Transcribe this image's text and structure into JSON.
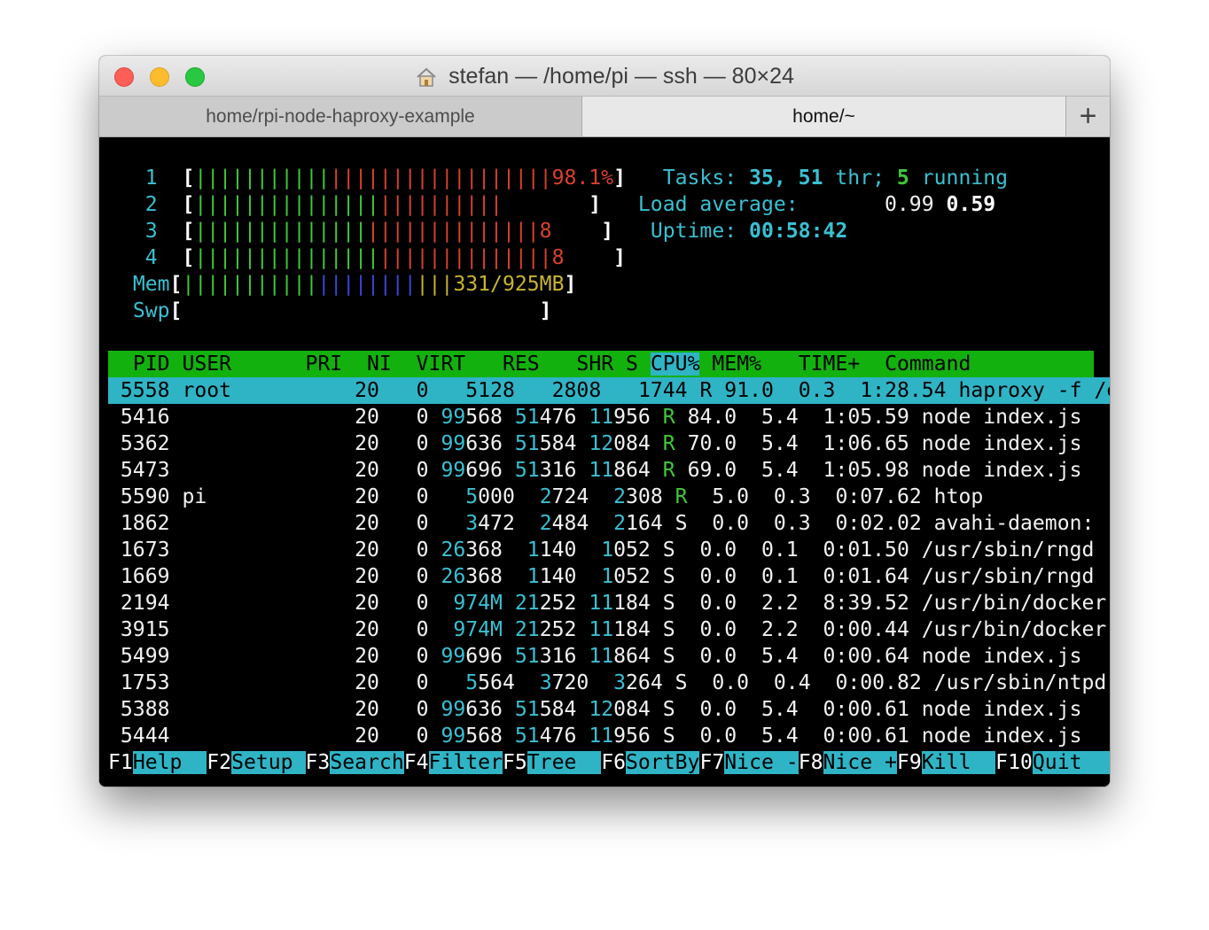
{
  "window": {
    "title": "stefan — /home/pi — ssh — 80×24",
    "tabs": [
      {
        "label": "home/rpi-node-haproxy-example",
        "active": false
      },
      {
        "label": "home/~",
        "active": true
      }
    ],
    "add_tab_label": "+"
  },
  "meters": {
    "cpu": [
      {
        "id": "1",
        "bar_green": "|||||||||||",
        "bar_red": "||||||||||||||||||",
        "label": "98.1%"
      },
      {
        "id": "2",
        "bar_green": "|||||||||||||||",
        "bar_red": "||||||||||",
        "label": ""
      },
      {
        "id": "3",
        "bar_green": "||||||||||||||",
        "bar_red": "||||||||||||||",
        "label": "8"
      },
      {
        "id": "4",
        "bar_green": "|||||||||||||||",
        "bar_red": "||||||||||||||",
        "label": "8"
      }
    ],
    "mem": {
      "id": "Mem",
      "bar_green": "|||||||||||",
      "bar_blue": "||||||||",
      "bar_yellow": "|||",
      "label": "331/925MB"
    },
    "swp": {
      "id": "Swp",
      "label": ""
    }
  },
  "summary": {
    "tasks_label": "Tasks:",
    "tasks_count": "35,",
    "threads_count": "51",
    "threads_label": "thr;",
    "running_count": "5",
    "running_label": "running",
    "load_label": "Load average:",
    "load_1": "0.99",
    "load_5": "0.59",
    "uptime_label": "Uptime:",
    "uptime_value": "00:58:42"
  },
  "table": {
    "columns": {
      "pid": "PID",
      "user": "USER",
      "pri": "PRI",
      "ni": "NI",
      "virt": "VIRT",
      "res": "RES",
      "shr": "SHR",
      "s": "S",
      "cpu": "CPU%",
      "mem": "MEM%",
      "time": "TIME+",
      "command": "Command"
    },
    "rows": [
      {
        "pid": "5558",
        "user": "root",
        "pri": "20",
        "ni": "0",
        "virt": "5128",
        "res": "2808",
        "shr": "1744",
        "s": "R",
        "cpu": "91.0",
        "mem": "0.3",
        "time": "1:28.54",
        "command": "haproxy -f /etc/h"
      },
      {
        "pid": "5416",
        "user": "",
        "pri": "20",
        "ni": "0",
        "virt": "99568",
        "res": "51476",
        "shr": "11956",
        "s": "R",
        "cpu": "84.0",
        "mem": "5.4",
        "time": "1:05.59",
        "command": "node index.js"
      },
      {
        "pid": "5362",
        "user": "",
        "pri": "20",
        "ni": "0",
        "virt": "99636",
        "res": "51584",
        "shr": "12084",
        "s": "R",
        "cpu": "70.0",
        "mem": "5.4",
        "time": "1:06.65",
        "command": "node index.js"
      },
      {
        "pid": "5473",
        "user": "",
        "pri": "20",
        "ni": "0",
        "virt": "99696",
        "res": "51316",
        "shr": "11864",
        "s": "R",
        "cpu": "69.0",
        "mem": "5.4",
        "time": "1:05.98",
        "command": "node index.js"
      },
      {
        "pid": "5590",
        "user": "pi",
        "pri": "20",
        "ni": "0",
        "virt": "5000",
        "res": "2724",
        "shr": "2308",
        "s": "R",
        "cpu": "5.0",
        "mem": "0.3",
        "time": "0:07.62",
        "command": "htop"
      },
      {
        "pid": "1862",
        "user": "",
        "pri": "20",
        "ni": "0",
        "virt": "3472",
        "res": "2484",
        "shr": "2164",
        "s": "S",
        "cpu": "0.0",
        "mem": "0.3",
        "time": "0:02.02",
        "command": "avahi-daemon: run"
      },
      {
        "pid": "1673",
        "user": "",
        "pri": "20",
        "ni": "0",
        "virt": "26368",
        "res": "1140",
        "shr": "1052",
        "s": "S",
        "cpu": "0.0",
        "mem": "0.1",
        "time": "0:01.50",
        "command": "/usr/sbin/rngd -r"
      },
      {
        "pid": "1669",
        "user": "",
        "pri": "20",
        "ni": "0",
        "virt": "26368",
        "res": "1140",
        "shr": "1052",
        "s": "S",
        "cpu": "0.0",
        "mem": "0.1",
        "time": "0:01.64",
        "command": "/usr/sbin/rngd -r"
      },
      {
        "pid": "2194",
        "user": "",
        "pri": "20",
        "ni": "0",
        "virt": "974M",
        "res": "21252",
        "shr": "11184",
        "s": "S",
        "cpu": "0.0",
        "mem": "2.2",
        "time": "8:39.52",
        "command": "/usr/bin/docker -"
      },
      {
        "pid": "3915",
        "user": "",
        "pri": "20",
        "ni": "0",
        "virt": "974M",
        "res": "21252",
        "shr": "11184",
        "s": "S",
        "cpu": "0.0",
        "mem": "2.2",
        "time": "0:00.44",
        "command": "/usr/bin/docker -"
      },
      {
        "pid": "5499",
        "user": "",
        "pri": "20",
        "ni": "0",
        "virt": "99696",
        "res": "51316",
        "shr": "11864",
        "s": "S",
        "cpu": "0.0",
        "mem": "5.4",
        "time": "0:00.64",
        "command": "node index.js"
      },
      {
        "pid": "1753",
        "user": "",
        "pri": "20",
        "ni": "0",
        "virt": "5564",
        "res": "3720",
        "shr": "3264",
        "s": "S",
        "cpu": "0.0",
        "mem": "0.4",
        "time": "0:00.82",
        "command": "/usr/sbin/ntpd -p"
      },
      {
        "pid": "5388",
        "user": "",
        "pri": "20",
        "ni": "0",
        "virt": "99636",
        "res": "51584",
        "shr": "12084",
        "s": "S",
        "cpu": "0.0",
        "mem": "5.4",
        "time": "0:00.61",
        "command": "node index.js"
      },
      {
        "pid": "5444",
        "user": "",
        "pri": "20",
        "ni": "0",
        "virt": "99568",
        "res": "51476",
        "shr": "11956",
        "s": "S",
        "cpu": "0.0",
        "mem": "5.4",
        "time": "0:00.61",
        "command": "node index.js"
      }
    ]
  },
  "function_keys": [
    {
      "key": "F1",
      "label": "Help"
    },
    {
      "key": "F2",
      "label": "Setup"
    },
    {
      "key": "F3",
      "label": "Search"
    },
    {
      "key": "F4",
      "label": "Filter"
    },
    {
      "key": "F5",
      "label": "Tree"
    },
    {
      "key": "F6",
      "label": "SortBy"
    },
    {
      "key": "F7",
      "label": "Nice -"
    },
    {
      "key": "F8",
      "label": "Nice +"
    },
    {
      "key": "F9",
      "label": "Kill"
    },
    {
      "key": "F10",
      "label": "Quit"
    }
  ],
  "colors": {
    "header_bg": "#13b10e",
    "selection_bg": "#2fb4c6",
    "cyan": "#3ac0d2",
    "green": "#3fc93a",
    "red": "#d9412c",
    "blue": "#3b46d8",
    "yellow": "#c9b431"
  }
}
